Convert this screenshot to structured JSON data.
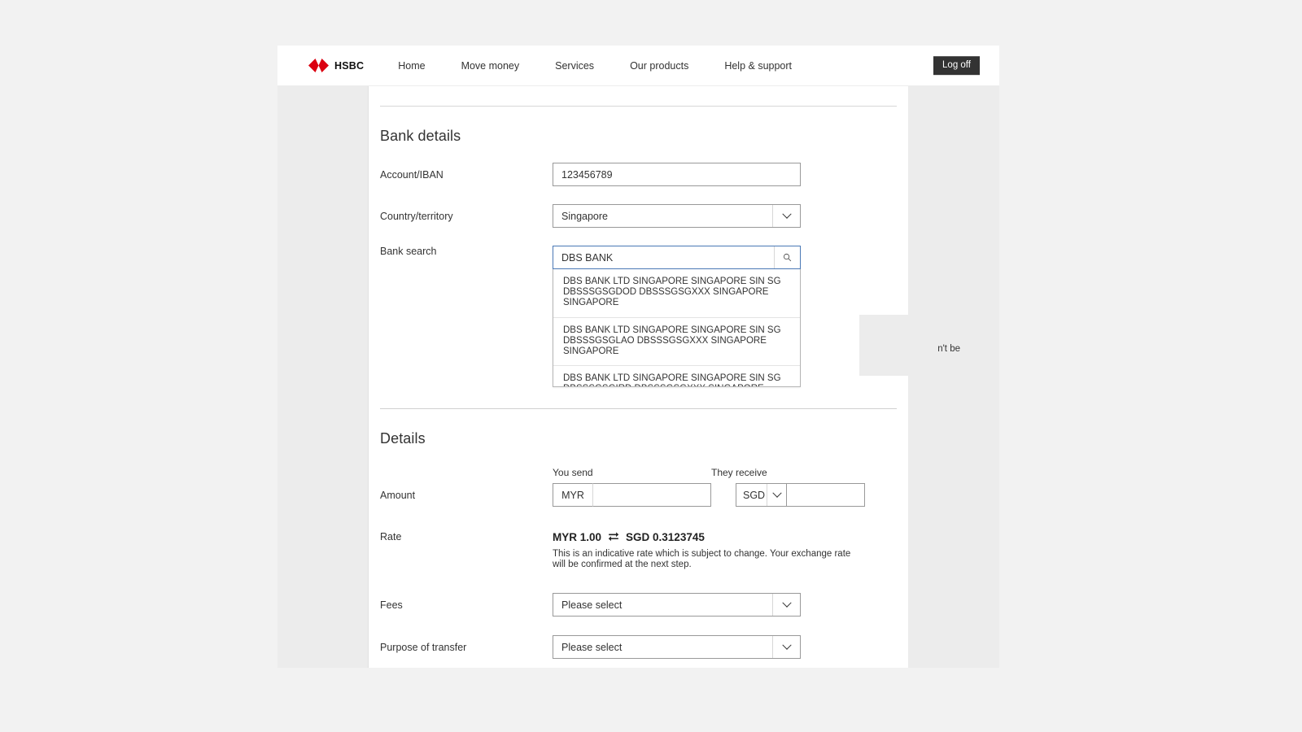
{
  "nav": {
    "brand_text": "HSBC",
    "links": [
      {
        "label": "Home"
      },
      {
        "label": "Move money"
      },
      {
        "label": "Services"
      },
      {
        "label": "Our products"
      },
      {
        "label": "Help & support"
      }
    ],
    "logoff_label": "Log off"
  },
  "bank_details": {
    "title": "Bank details",
    "account_label": "Account/IBAN",
    "account_value": "123456789",
    "country_label": "Country/territory",
    "country_value": "Singapore",
    "bank_search_label": "Bank search",
    "bank_search_value": "DBS BANK",
    "suggestions": [
      "DBS BANK LTD SINGAPORE SINGAPORE SIN SG DBSSSGSGDOD DBSSSGSGXXX SINGAPORE SINGAPORE",
      "DBS BANK LTD SINGAPORE SINGAPORE SIN SG DBSSSGSGLAO DBSSSGSGXXX SINGAPORE SINGAPORE",
      "DBS BANK LTD SINGAPORE SINGAPORE SIN SG DBSSSGSGIRD DBSSSGSGXXX SINGAPORE SINGAPORE"
    ],
    "info_panel_text": "n't be"
  },
  "details": {
    "title": "Details",
    "amount_label": "Amount",
    "you_send_label": "You send",
    "they_receive_label": "They receive",
    "send_currency": "MYR",
    "send_amount": "",
    "receive_currency": "SGD",
    "receive_amount": "",
    "rate_label": "Rate",
    "rate_value": "MYR 1.00",
    "rate_value_2": "SGD 0.3123745",
    "rate_note": "This is an indicative rate which is subject to change. Your exchange rate will be confirmed at the next step.",
    "fees_label": "Fees",
    "fees_value": "Please select",
    "purpose_label": "Purpose of transfer",
    "purpose_value": "Please select"
  },
  "colors": {
    "brand_red": "#db0011",
    "page_bg": "#f2f2f2",
    "rail_bg": "#ececec",
    "logoff_bg": "#333333",
    "focus_border": "#4a78b5"
  }
}
